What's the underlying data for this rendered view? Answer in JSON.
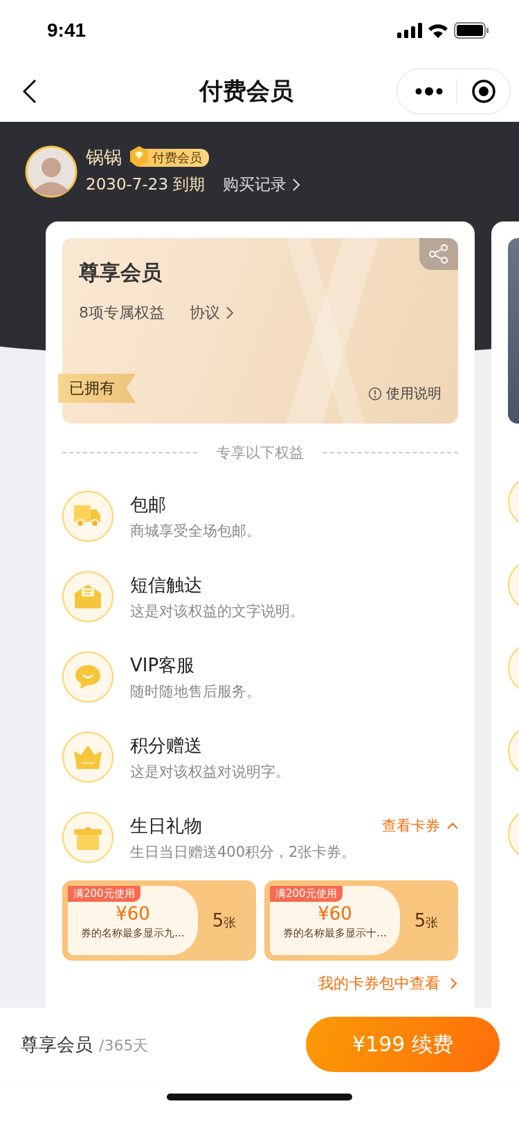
{
  "status_bar": {
    "time": "9:41"
  },
  "nav": {
    "title": "付费会员"
  },
  "user": {
    "name": "锅锅",
    "badge": "付费会员",
    "expiry": "2030-7-23 到期",
    "records": "购买记录"
  },
  "plan": {
    "title": "尊享会员",
    "benefit_count": "8项专属权益",
    "agreement": "协议",
    "owned_tag": "已拥有",
    "help": "使用说明"
  },
  "section_heading": "专享以下权益",
  "benefits": [
    {
      "kind": "truck",
      "title": "包邮",
      "desc": "商城享受全场包邮。"
    },
    {
      "kind": "envelope",
      "title": "短信触达",
      "desc": "这是对该权益的文字说明。"
    },
    {
      "kind": "chat",
      "title": "VIP客服",
      "desc": "随时随地售后服务。"
    },
    {
      "kind": "crown",
      "title": "积分赠送",
      "desc": "这是对该权益对说明字。"
    },
    {
      "kind": "gift",
      "title": "生日礼物",
      "desc": "生日当日赠送400积分，2张卡券。",
      "action": "查看卡券",
      "expanded": true
    }
  ],
  "coupons": [
    {
      "condition": "满200元使用",
      "amount": "¥60",
      "name": "券的名称最多显示九...",
      "count": "5",
      "unit": "张"
    },
    {
      "condition": "满200元使用",
      "amount": "¥60",
      "name": "券的名称最多显示十...",
      "count": "5",
      "unit": "张"
    }
  ],
  "coupon_link": "我的卡券包中查看",
  "footer": {
    "plan": "尊享会员",
    "period": "/365天",
    "button": "¥199 续费"
  }
}
